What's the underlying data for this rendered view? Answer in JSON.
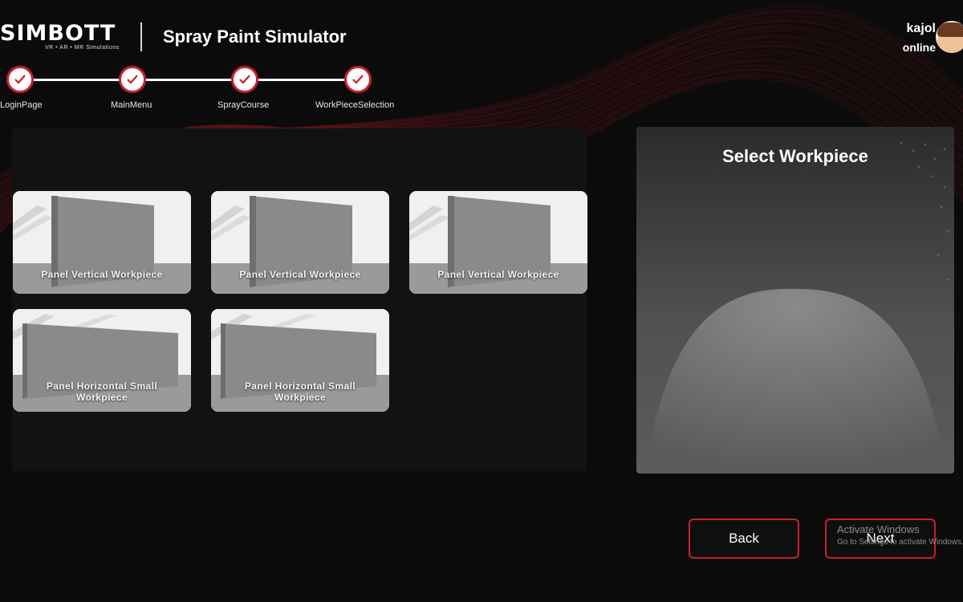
{
  "header": {
    "logo_text": "SIMBOTT",
    "logo_tagline": "VR • AR • MR Simulations",
    "app_title": "Spray Paint Simulator"
  },
  "user": {
    "name": "kajol",
    "status": "online"
  },
  "steps": [
    {
      "label": "LoginPage",
      "completed": true
    },
    {
      "label": "MainMenu",
      "completed": true
    },
    {
      "label": "SprayCourse",
      "completed": true
    },
    {
      "label": "WorkPieceSelection",
      "completed": true
    }
  ],
  "workpieces": [
    {
      "label": "Panel Vertical Workpiece"
    },
    {
      "label": "Panel Vertical Workpiece"
    },
    {
      "label": "Panel Vertical Workpiece"
    },
    {
      "label": "Panel Horizontal Small Workpiece"
    },
    {
      "label": "Panel Horizontal Small Workpiece"
    }
  ],
  "preview": {
    "title": "Select Workpiece"
  },
  "buttons": {
    "back": "Back",
    "next": "Next"
  },
  "watermark": {
    "line1": "Activate Windows",
    "line2": "Go to Settings to activate Windows."
  },
  "colors": {
    "accent": "#c8202c",
    "background": "#0b0b0b"
  }
}
